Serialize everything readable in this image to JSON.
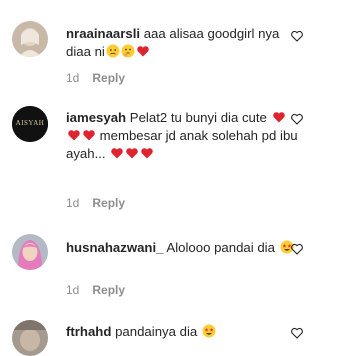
{
  "comments": [
    {
      "username": "nraainaarsli",
      "text": "aaa alisaa goodgirl nya diaa ni",
      "time": "1d",
      "reply_label": "Reply"
    },
    {
      "username": "iamesyah",
      "text": "Pelat2 tu bunyi dia cute",
      "text2": "membesar jd anak solehah pd ibu ayah...",
      "time": "1d",
      "reply_label": "Reply",
      "avatar_text": "AISYAH"
    },
    {
      "username": "husnahazwani_",
      "text": "Alolooo pandai dia",
      "time": "1d",
      "reply_label": "Reply"
    },
    {
      "username": "ftrhahd",
      "text": "pandainya dia"
    }
  ],
  "icons": {
    "like": "heart-outline-icon",
    "heart_emoji": "red-heart-emoji",
    "star_eyes_emoji": "star-struck-emoji",
    "sad_emoji": "sad-face-emoji",
    "thinking_emoji": "thinking-face-emoji"
  },
  "colors": {
    "text": "#262626",
    "meta": "#8e8e8e",
    "heart": "#ed4956",
    "emoji_yellow": "#ffcc33"
  }
}
